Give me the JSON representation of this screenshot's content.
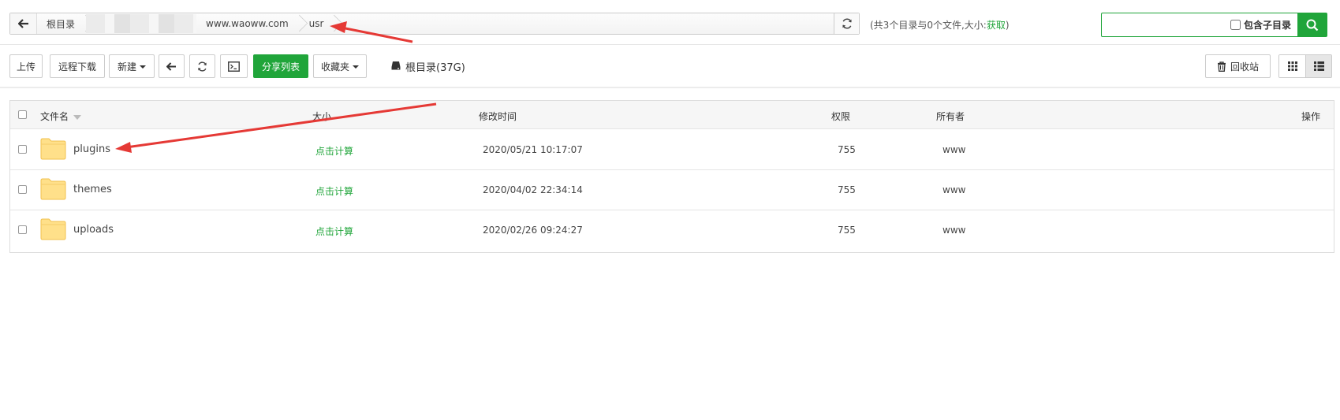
{
  "pathbar": {
    "crumbs": [
      "根目录",
      "",
      "www.waoww.com",
      "usr"
    ],
    "summary_prefix": "(共3个目录与0个文件,大小:",
    "summary_link": "获取",
    "summary_suffix": ")"
  },
  "search": {
    "placeholder": "",
    "include_subdir": "包含子目录"
  },
  "toolbar": {
    "upload": "上传",
    "remote_download": "远程下载",
    "new": "新建",
    "share_list": "分享列表",
    "favorites": "收藏夹",
    "disk": "根目录(37G)",
    "recycle_bin": "回收站"
  },
  "table": {
    "headers": {
      "name": "文件名",
      "size": "大小",
      "mtime": "修改时间",
      "perm": "权限",
      "owner": "所有者",
      "actions": "操作"
    },
    "rows": [
      {
        "name": "plugins",
        "size": "点击计算",
        "mtime": "2020/05/21 10:17:07",
        "perm": "755",
        "owner": "www"
      },
      {
        "name": "themes",
        "size": "点击计算",
        "mtime": "2020/04/02 22:34:14",
        "perm": "755",
        "owner": "www"
      },
      {
        "name": "uploads",
        "size": "点击计算",
        "mtime": "2020/02/26 09:24:27",
        "perm": "755",
        "owner": "www"
      }
    ]
  },
  "colors": {
    "accent_green": "#20a53a",
    "annotation_red": "#e53935",
    "folder_yellow": "#ffe08a"
  }
}
